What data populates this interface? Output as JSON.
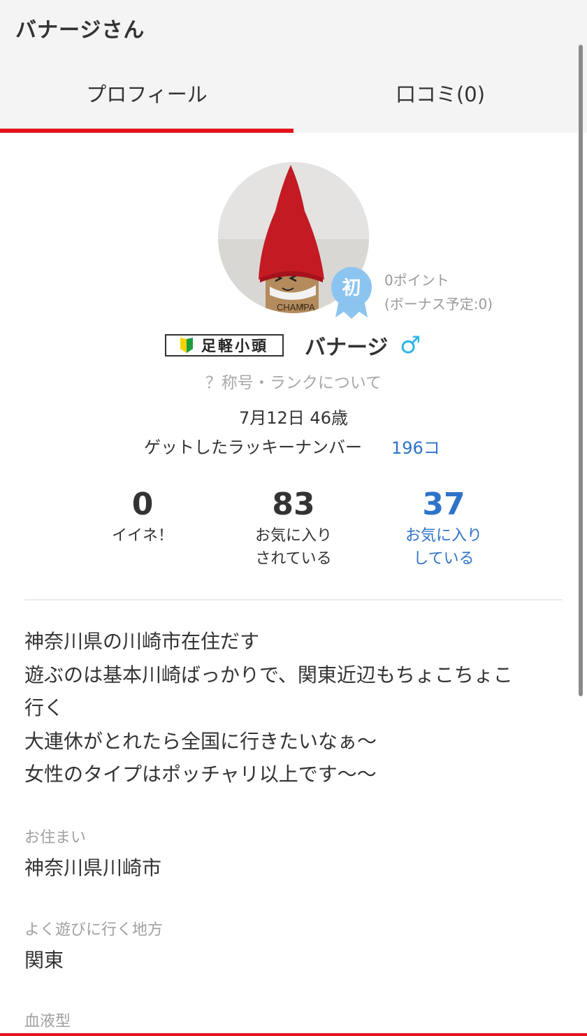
{
  "header": {
    "title": "バナージさん"
  },
  "tabs": [
    {
      "label": "プロフィール",
      "active": true
    },
    {
      "label": "口コミ(0)",
      "active": false
    }
  ],
  "profile": {
    "rank_badge": "初",
    "points": "0ポイント",
    "bonus": "(ボーナス予定:0)",
    "title_plate": "足軽小頭",
    "name": "バナージ",
    "gender_symbol": "♂",
    "rank_link": "？称号・ランクについて",
    "birthday_age": "7月12日 46歳",
    "lucky_label": "ゲットしたラッキーナンバー",
    "lucky_count": "196コ"
  },
  "stats": [
    {
      "value": "0",
      "label": "イイネ！"
    },
    {
      "value": "83",
      "label": "お気に入り\nされている"
    },
    {
      "value": "37",
      "label": "お気に入り\nしている"
    }
  ],
  "bio": [
    "神奈川県の川崎市在住だす",
    "遊ぶのは基本川崎ばっかりで、関東近辺もちょこちょこ",
    "行く",
    "大連休がとれたら全国に行きたいなぁ〜",
    "女性のタイプはポッチャリ以上です〜〜"
  ],
  "fields": [
    {
      "label": "お住まい",
      "value": "神奈川県川崎市"
    },
    {
      "label": "よく遊びに行く地方",
      "value": "関東"
    },
    {
      "label": "血液型",
      "value": ""
    }
  ],
  "colors": {
    "accent_red": "#e2131c",
    "link_blue": "#2e73c8",
    "gender_blue": "#2bb6e5",
    "badge_blue": "#8cc4f0"
  }
}
